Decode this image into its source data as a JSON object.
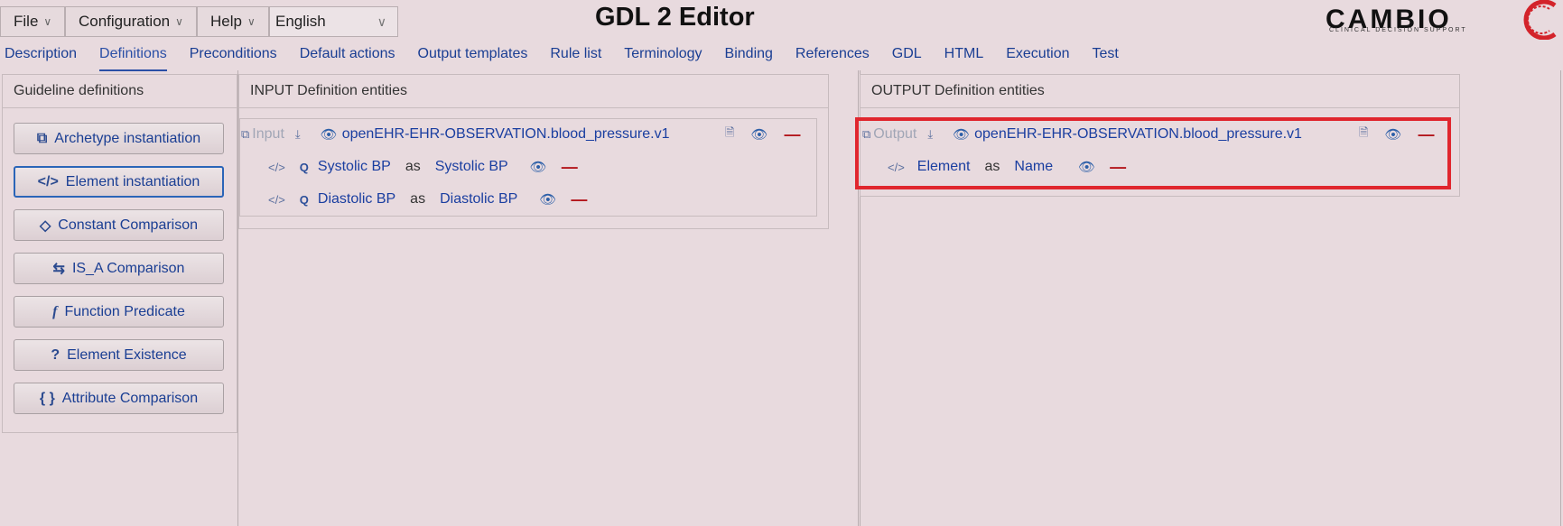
{
  "menus": [
    {
      "label": "File"
    },
    {
      "label": "Configuration"
    },
    {
      "label": "Help"
    }
  ],
  "language": {
    "value": "English"
  },
  "app_title": "GDL 2 Editor",
  "logo": {
    "text": "CAMBIO",
    "subtitle": "CLINICAL DECISION SUPPORT"
  },
  "tabs": [
    "Description",
    "Definitions",
    "Preconditions",
    "Default actions",
    "Output templates",
    "Rule list",
    "Terminology",
    "Binding",
    "References",
    "GDL",
    "HTML",
    "Execution",
    "Test"
  ],
  "active_tab": "Definitions",
  "left_panel": {
    "title": "Guideline definitions",
    "buttons": [
      {
        "label": "Archetype instantiation",
        "icon": "archetype-icon"
      },
      {
        "label": "Element instantiation",
        "icon": "code-icon"
      },
      {
        "label": "Constant Comparison",
        "icon": "diamond-icon"
      },
      {
        "label": "IS_A Comparison",
        "icon": "arrows-icon"
      },
      {
        "label": "Function Predicate",
        "icon": "function-icon"
      },
      {
        "label": "Element Existence",
        "icon": "question-icon"
      },
      {
        "label": "Attribute Comparison",
        "icon": "braces-icon"
      }
    ]
  },
  "input_panel": {
    "title": "INPUT Definition entities",
    "entity": {
      "type_label": "Input",
      "archetype": "openEHR-EHR-OBSERVATION.blood_pressure.v1"
    },
    "elements": [
      {
        "name": "Systolic BP",
        "as": "as",
        "alias": "Systolic BP"
      },
      {
        "name": "Diastolic BP",
        "as": "as",
        "alias": "Diastolic BP"
      }
    ]
  },
  "output_panel": {
    "title": "OUTPUT Definition entities",
    "entity": {
      "type_label": "Output",
      "archetype": "openEHR-EHR-OBSERVATION.blood_pressure.v1"
    },
    "elements": [
      {
        "name": "Element",
        "as": "as",
        "alias": "Name"
      }
    ]
  },
  "colors": {
    "background": "#e8dade",
    "link": "#1a3ea0",
    "remove": "#b3161b",
    "highlight": "#e0262e"
  }
}
